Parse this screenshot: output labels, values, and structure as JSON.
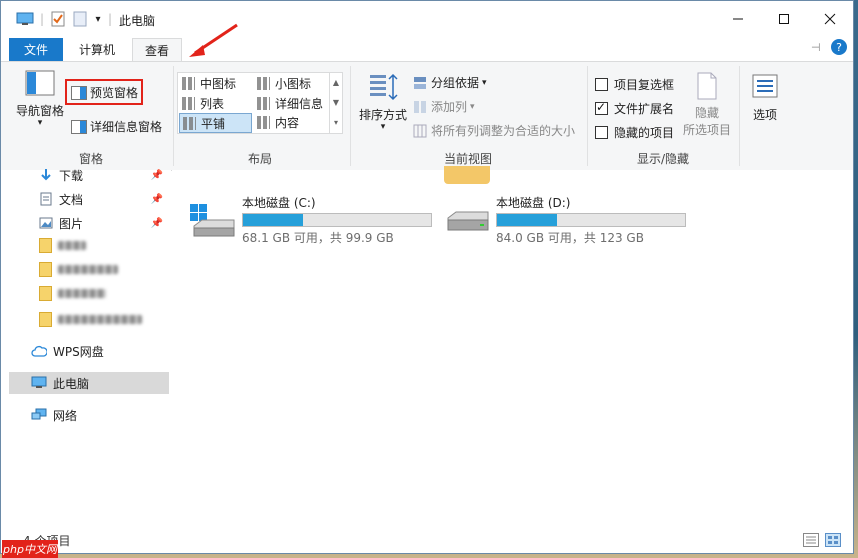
{
  "window": {
    "title": "此电脑"
  },
  "tabs": {
    "file": "文件",
    "computer": "计算机",
    "view": "查看"
  },
  "ribbon": {
    "panes": {
      "label": "窗格",
      "nav_pane": "导航窗格",
      "preview_pane": "预览窗格",
      "details_pane": "详细信息窗格"
    },
    "layout": {
      "label": "布局",
      "options": [
        "中图标",
        "小图标",
        "列表",
        "详细信息",
        "平铺",
        "内容"
      ]
    },
    "current_view": {
      "label": "当前视图",
      "sort_by": "排序方式",
      "group_by": "分组依据",
      "add_columns": "添加列",
      "size_all_columns": "将所有列调整为合适的大小"
    },
    "show_hide": {
      "label": "显示/隐藏",
      "item_checkboxes": "项目复选框",
      "file_extensions": "文件扩展名",
      "hidden_items": "隐藏的项目",
      "hide_selected_line1": "隐藏",
      "hide_selected_line2": "所选项目",
      "options": "选项"
    }
  },
  "nav": {
    "downloads": "下载",
    "documents": "文档",
    "pictures": "图片",
    "wps_drive": "WPS网盘",
    "this_pc": "此电脑",
    "network": "网络"
  },
  "drives": [
    {
      "name": "本地磁盘 (C:)",
      "space": "68.1 GB 可用，共 99.9 GB",
      "used_fraction": 0.318
    },
    {
      "name": "本地磁盘 (D:)",
      "space": "84.0 GB 可用，共 123 GB",
      "used_fraction": 0.317
    }
  ],
  "status": {
    "items": "4 个项目"
  },
  "watermark": "php中文网",
  "colors": {
    "accent": "#1979ca",
    "drive_bar": "#26a0da",
    "annotation": "#e2231a"
  }
}
